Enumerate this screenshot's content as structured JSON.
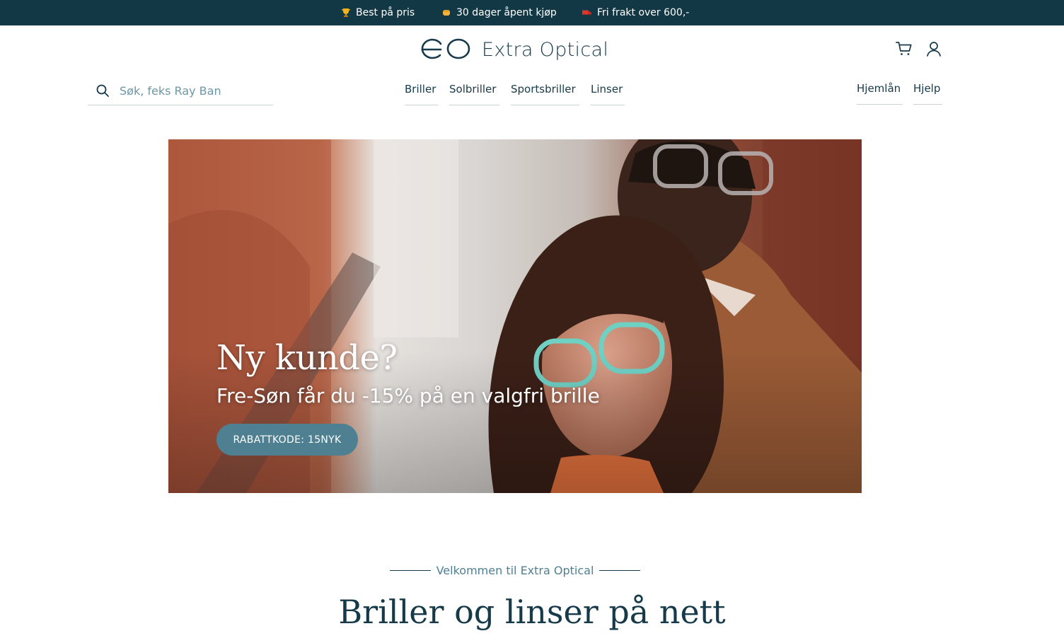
{
  "topbar": {
    "items": [
      {
        "icon": "trophy-icon",
        "label": "Best på pris"
      },
      {
        "icon": "fist-bump-icon",
        "label": "30 dager åpent kjøp"
      },
      {
        "icon": "delivery-truck-icon",
        "label": "Fri frakt over 600,-"
      }
    ]
  },
  "header": {
    "logo_text": "Extra Optical",
    "cart_icon": "cart-icon",
    "account_icon": "user-icon"
  },
  "search": {
    "placeholder": "Søk, feks Ray Ban",
    "value": ""
  },
  "nav": {
    "main": [
      "Briller",
      "Solbriller",
      "Sportsbriller",
      "Linser"
    ],
    "secondary": [
      "Hjemlån",
      "Hjelp"
    ]
  },
  "hero": {
    "title": "Ny kunde?",
    "subtitle": "Fre-Søn får du -15% på en valgfri brille",
    "cta": "RABATTKODE: 15NYK"
  },
  "welcome": {
    "kicker": "Velkommen til Extra Optical",
    "title": "Briller og linser på nett"
  },
  "colors": {
    "topbar_bg": "#123745",
    "text_dark": "#163a4a",
    "accent": "#4f8092"
  }
}
